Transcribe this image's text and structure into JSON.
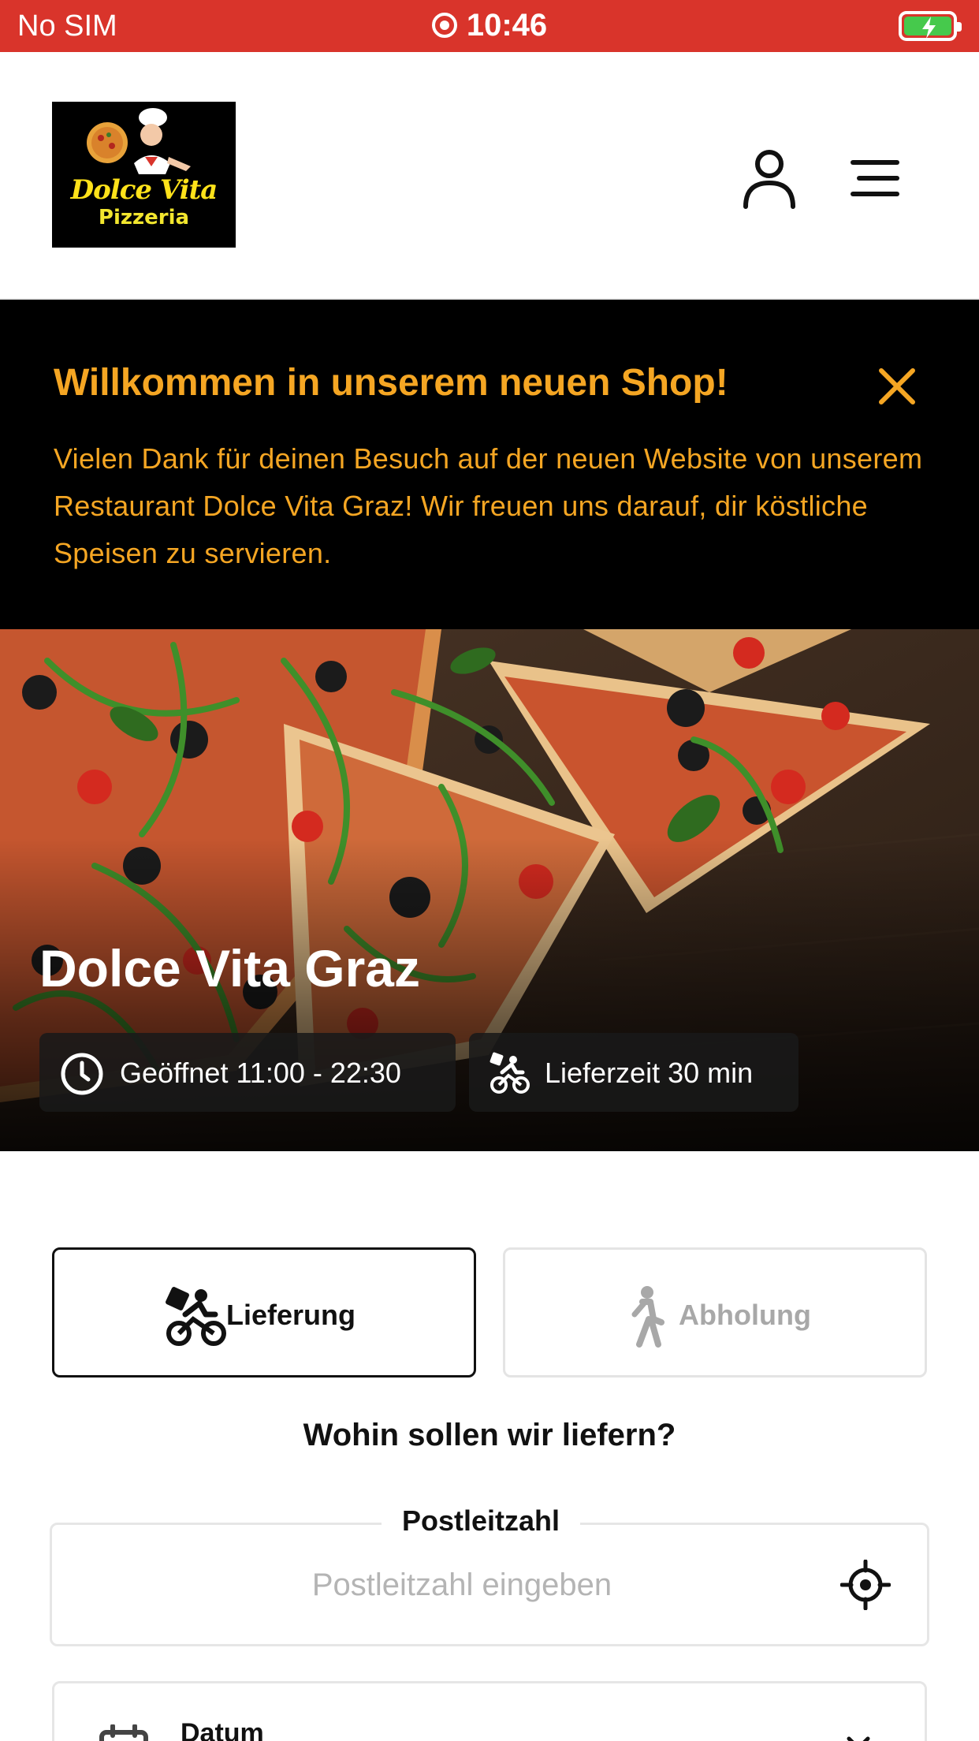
{
  "status_bar": {
    "carrier": "No SIM",
    "time": "10:46"
  },
  "header": {
    "logo_title": "Dolce Vita",
    "logo_subtitle": "Pizzeria"
  },
  "banner": {
    "title": "Willkommen in unserem neuen Shop!",
    "text": "Vielen Dank für deinen Besuch auf der neuen Website von unserem Restaurant Dolce Vita Graz! Wir freuen uns darauf, dir köstliche Speisen zu servieren."
  },
  "hero": {
    "restaurant_name": "Dolce Vita Graz",
    "opening_hours": "Geöffnet 11:00 - 22:30",
    "delivery_time": "Lieferzeit 30 min"
  },
  "order_type": {
    "delivery_label": "Lieferung",
    "pickup_label": "Abholung",
    "selected": "Lieferung"
  },
  "delivery_form": {
    "question": "Wohin sollen wir liefern?",
    "zip_label": "Postleitzahl",
    "zip_value": "",
    "zip_placeholder": "Postleitzahl eingeben",
    "date_label": "Datum"
  },
  "colors": {
    "status_bar": "#d9342b",
    "accent": "#f5a623",
    "banner_bg": "#000000"
  },
  "icons": {
    "status": [
      "recording-icon",
      "battery-charging-icon"
    ],
    "header": [
      "user-icon",
      "menu-icon"
    ],
    "banner": [
      "close-icon"
    ],
    "hero": [
      "clock-icon",
      "delivery-bike-icon"
    ],
    "order_type": [
      "delivery-bike-icon",
      "walking-icon"
    ],
    "form": [
      "locate-icon",
      "calendar-icon",
      "chevron-down-icon"
    ]
  }
}
